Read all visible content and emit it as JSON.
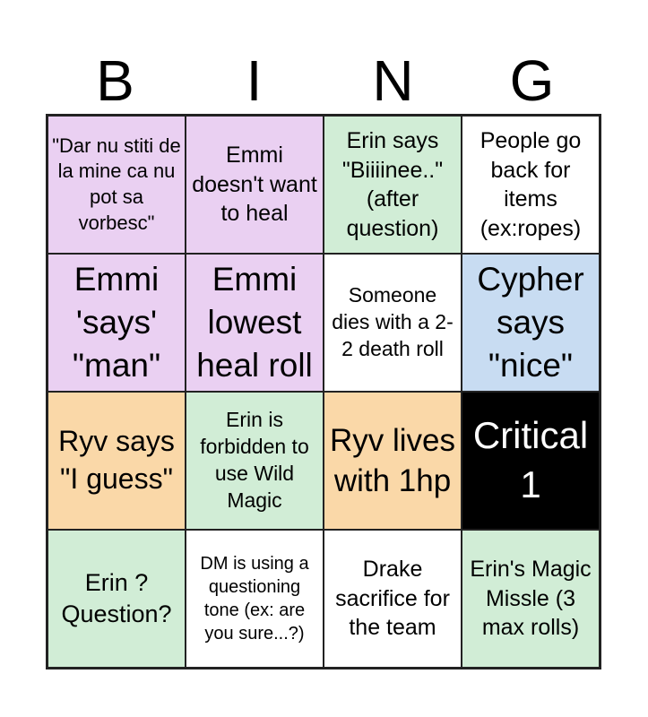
{
  "header": {
    "letters": [
      "B",
      "I",
      "N",
      "G"
    ]
  },
  "colors": {
    "purple": "#ead0f2",
    "green": "#d1edd6",
    "white": "#ffffff",
    "blue": "#c8dcf2",
    "orange": "#fad8a8",
    "black": "#000000"
  },
  "cells": [
    {
      "text": "\"Dar nu stiti de la mine ca nu pot sa vorbesc\"",
      "color": "purple",
      "size": 22
    },
    {
      "text": "Emmi doesn't want to heal",
      "color": "purple",
      "size": 25
    },
    {
      "text": "Erin says \"Biiiinee..\" (after question)",
      "color": "green",
      "size": 25
    },
    {
      "text": "People go back for items (ex:ropes)",
      "color": "white",
      "size": 25
    },
    {
      "text": "Emmi 'says' \"man\"",
      "color": "purple",
      "size": 37
    },
    {
      "text": "Emmi lowest heal roll",
      "color": "purple",
      "size": 37
    },
    {
      "text": "Someone dies with a 2-2 death roll",
      "color": "white",
      "size": 23
    },
    {
      "text": "Cypher says \"nice\"",
      "color": "blue",
      "size": 37
    },
    {
      "text": "Ryv says \"I guess\"",
      "color": "orange",
      "size": 32
    },
    {
      "text": "Erin is forbidden to use Wild Magic",
      "color": "green",
      "size": 23
    },
    {
      "text": "Ryv lives with 1hp",
      "color": "orange",
      "size": 35
    },
    {
      "text": "Critical 1",
      "color": "black",
      "size": 42
    },
    {
      "text": "Erin ? Question?",
      "color": "green",
      "size": 27
    },
    {
      "text": "DM is using a questioning tone (ex: are you sure...?)",
      "color": "white",
      "size": 20
    },
    {
      "text": "Drake sacrifice for the team",
      "color": "white",
      "size": 25
    },
    {
      "text": "Erin's Magic Missle (3 max rolls)",
      "color": "green",
      "size": 25
    }
  ]
}
